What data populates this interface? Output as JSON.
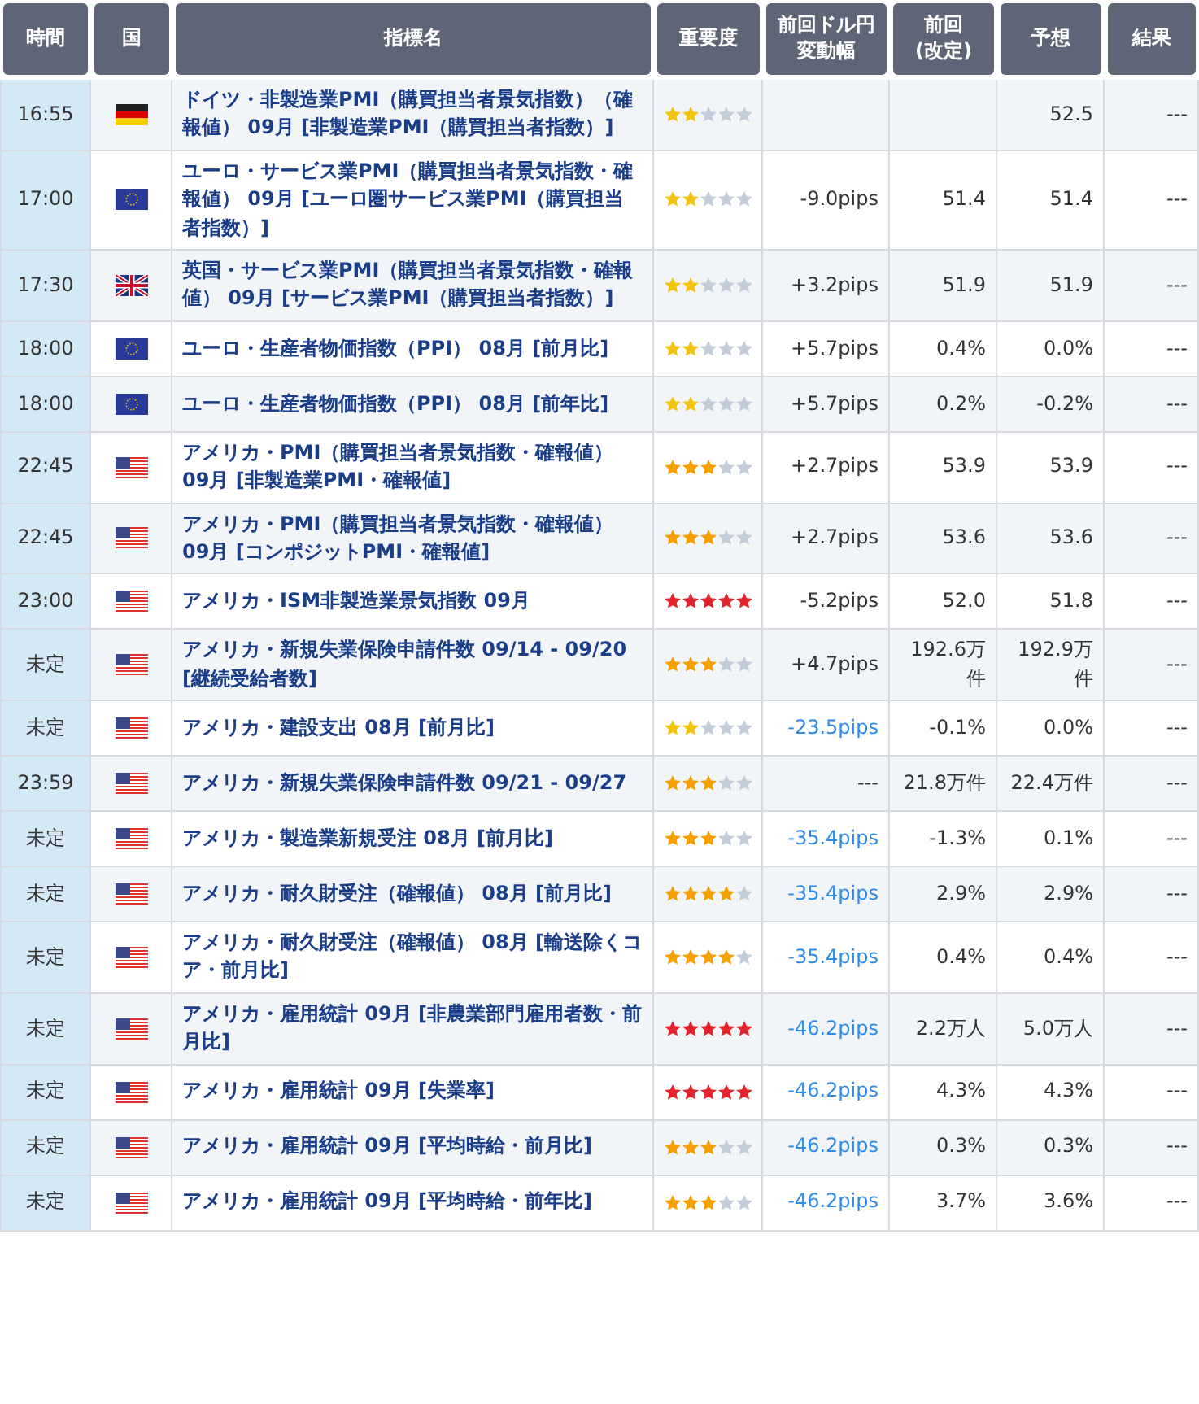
{
  "columns": [
    "時間",
    "国",
    "指標名",
    "重要度",
    "前回ドル円変動幅",
    "前回\n(改定)",
    "予想",
    "結果"
  ],
  "rows": [
    {
      "time": "16:55",
      "kind": "de",
      "name": "ドイツ・非製造業PMI（購買担当者景気指数）（確報値） 09月 [非製造業PMI（購買担当者指数）]",
      "stars": 2,
      "forecast": "52.5",
      "result": "---"
    },
    {
      "time": "17:00",
      "kind": "eu",
      "name": "ユーロ・サービス業PMI（購買担当者景気指数・確報値） 09月 [ユーロ圏サービス業PMI（購買担当者指数）]",
      "stars": 2,
      "change": "-9.0pips",
      "linked": false,
      "previous": "51.4",
      "forecast": "51.4",
      "result": "---"
    },
    {
      "time": "17:30",
      "kind": "gb",
      "name": "英国・サービス業PMI（購買担当者景気指数・確報値） 09月 [サービス業PMI（購買担当者指数）]",
      "stars": 2,
      "change": "+3.2pips",
      "linked": false,
      "previous": "51.9",
      "forecast": "51.9",
      "result": "---"
    },
    {
      "time": "18:00",
      "kind": "eu",
      "name": "ユーロ・生産者物価指数（PPI） 08月 [前月比]",
      "stars": 2,
      "change": "+5.7pips",
      "linked": false,
      "previous": "0.4%",
      "forecast": "0.0%",
      "result": "---"
    },
    {
      "time": "18:00",
      "kind": "eu",
      "name": "ユーロ・生産者物価指数（PPI） 08月 [前年比]",
      "stars": 2,
      "change": "+5.7pips",
      "linked": false,
      "previous": "0.2%",
      "forecast": "-0.2%",
      "result": "---"
    },
    {
      "time": "22:45",
      "kind": "us",
      "name": "アメリカ・PMI（購買担当者景気指数・確報値） 09月 [非製造業PMI・確報値]",
      "stars": 3,
      "change": "+2.7pips",
      "linked": false,
      "previous": "53.9",
      "forecast": "53.9",
      "result": "---"
    },
    {
      "time": "22:45",
      "kind": "us",
      "name": "アメリカ・PMI（購買担当者景気指数・確報値） 09月 [コンポジットPMI・確報値]",
      "stars": 3,
      "change": "+2.7pips",
      "linked": false,
      "previous": "53.6",
      "forecast": "53.6",
      "result": "---"
    },
    {
      "time": "23:00",
      "kind": "us",
      "name": "アメリカ・ISM非製造業景気指数 09月",
      "stars": 5,
      "change": "-5.2pips",
      "linked": false,
      "previous": "52.0",
      "forecast": "51.8",
      "result": "---"
    },
    {
      "time": "未定",
      "kind": "us",
      "name": "アメリカ・新規失業保険申請件数 09/14 - 09/20 [継続受給者数]",
      "stars": 3,
      "change": "+4.7pips",
      "linked": false,
      "previous": "192.6万件",
      "forecast": "192.9万件",
      "result": "---"
    },
    {
      "time": "未定",
      "kind": "us",
      "name": "アメリカ・建設支出 08月 [前月比]",
      "stars": 2,
      "change": "-23.5pips",
      "linked": true,
      "previous": "-0.1%",
      "forecast": "0.0%",
      "result": "---"
    },
    {
      "time": "23:59",
      "kind": "us",
      "name": "アメリカ・新規失業保険申請件数 09/21 - 09/27",
      "stars": 3,
      "change": "---",
      "linked": false,
      "previous": "21.8万件",
      "forecast": "22.4万件",
      "result": "---"
    },
    {
      "time": "未定",
      "kind": "us",
      "name": "アメリカ・製造業新規受注 08月 [前月比]",
      "stars": 3,
      "change": "-35.4pips",
      "linked": true,
      "previous": "-1.3%",
      "forecast": "0.1%",
      "result": "---"
    },
    {
      "time": "未定",
      "kind": "us",
      "name": "アメリカ・耐久財受注（確報値） 08月 [前月比]",
      "stars": 4,
      "change": "-35.4pips",
      "linked": true,
      "previous": "2.9%",
      "forecast": "2.9%",
      "result": "---"
    },
    {
      "time": "未定",
      "kind": "us",
      "name": "アメリカ・耐久財受注（確報値） 08月 [輸送除くコア・前月比]",
      "stars": 4,
      "change": "-35.4pips",
      "linked": true,
      "previous": "0.4%",
      "forecast": "0.4%",
      "result": "---"
    },
    {
      "time": "未定",
      "kind": "us",
      "name": "アメリカ・雇用統計 09月 [非農業部門雇用者数・前月比]",
      "stars": 5,
      "change": "-46.2pips",
      "linked": true,
      "previous": "2.2万人",
      "forecast": "5.0万人",
      "result": "---"
    },
    {
      "time": "未定",
      "kind": "us",
      "name": "アメリカ・雇用統計 09月 [失業率]",
      "stars": 5,
      "change": "-46.2pips",
      "linked": true,
      "previous": "4.3%",
      "forecast": "4.3%",
      "result": "---"
    },
    {
      "time": "未定",
      "kind": "us",
      "name": "アメリカ・雇用統計 09月 [平均時給・前月比]",
      "stars": 3,
      "change": "-46.2pips",
      "linked": true,
      "previous": "0.3%",
      "forecast": "0.3%",
      "result": "---"
    },
    {
      "time": "未定",
      "kind": "us",
      "name": "アメリカ・雇用統計 09月 [平均時給・前年比]",
      "stars": 3,
      "change": "-46.2pips",
      "linked": true,
      "previous": "3.7%",
      "forecast": "3.6%",
      "result": "---"
    }
  ]
}
